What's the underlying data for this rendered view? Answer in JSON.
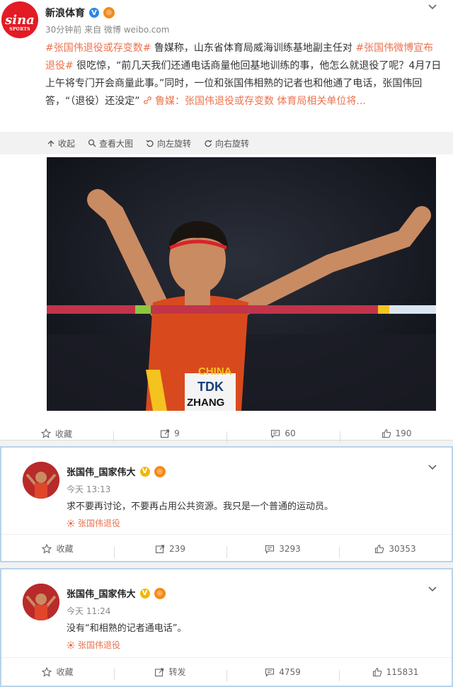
{
  "post": {
    "username": "新浪体育",
    "meta": "30分钟前 来自 微博 weibo.com",
    "logo_text": "sina",
    "logo_sub": "SPORTS",
    "content_hashtag1": "#张国伟退役或存变数#",
    "content_text1": " 鲁媒称，山东省体育局威海训练基地副主任对 ",
    "content_hashtag2": "#张国伟微博宣布退役#",
    "content_text2": " 很吃惊，“前几天我们还通电话商量他回基地训练的事，他怎么就退役了呢？4月7日上午将专门开会商量此事。”同时，一位和张国伟相熟的记者也和他通了电话，张国伟回答，“（退役）还没定” ",
    "content_link": "鲁媒：张国伟退役或存变数 体育局相关单位将...",
    "toolbar": [
      "收起",
      "查看大图",
      "向左旋转",
      "向右旋转"
    ],
    "photo_bib_text": "TDK",
    "photo_name_text": "ZHANG",
    "photo_china_text": "CHINA",
    "actions": {
      "collect": "收藏",
      "repost": "9",
      "comment": "60",
      "like": "190"
    }
  },
  "replies": [
    {
      "username": "张国伟_国家伟大",
      "time": "今天 13:13",
      "text": "求不要再讨论，不要再占用公共资源。我只是一个普通的运动员。",
      "topic": "张国伟退役",
      "actions": {
        "collect": "收藏",
        "repost": "239",
        "comment": "3293",
        "like": "30353"
      }
    },
    {
      "username": "张国伟_国家伟大",
      "time": "今天 11:24",
      "text": "没有“和相熟的记者通电话”。",
      "topic": "张国伟退役",
      "actions": {
        "collect": "收藏",
        "repost": "转发",
        "comment": "4759",
        "like": "115831"
      }
    }
  ],
  "colors": {
    "accent": "#eb7350",
    "sina_red": "#e21b24",
    "reply_border": "#b9d3ec"
  }
}
